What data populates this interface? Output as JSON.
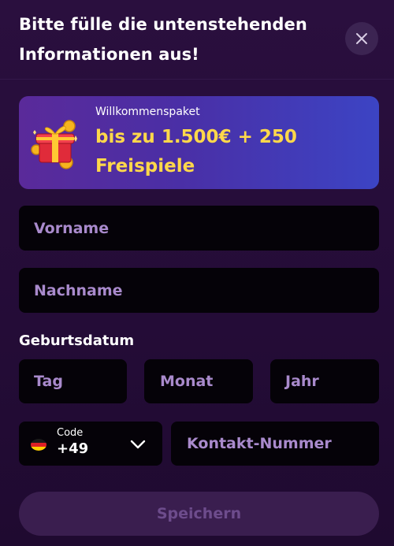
{
  "header": {
    "title_line1": "Bitte fülle die untenstehenden",
    "title_line2": "Informationen aus!"
  },
  "banner": {
    "subtitle": "Willkommenspaket",
    "headline_line1": "bis zu 1.500€ + 250",
    "headline_line2": "Freispiele"
  },
  "form": {
    "first_name_placeholder": "Vorname",
    "last_name_placeholder": "Nachname",
    "dob_label": "Geburtsdatum",
    "day_placeholder": "Tag",
    "month_placeholder": "Monat",
    "year_placeholder": "Jahr",
    "code_label": "Code",
    "code_value": "+49",
    "phone_placeholder": "Kontakt-Nummer",
    "save_label": "Speichern"
  },
  "icons": {
    "close": "close-icon",
    "gift": "gift-icon",
    "flag": "germany-flag-icon",
    "chevron": "chevron-down-icon"
  },
  "colors": {
    "background": "#240c37",
    "field": "#050208",
    "placeholder": "#a98acc",
    "accent_yellow": "#ffd84a",
    "button_disabled": "#3a1e4f",
    "button_text_disabled": "#6d4c8c"
  }
}
